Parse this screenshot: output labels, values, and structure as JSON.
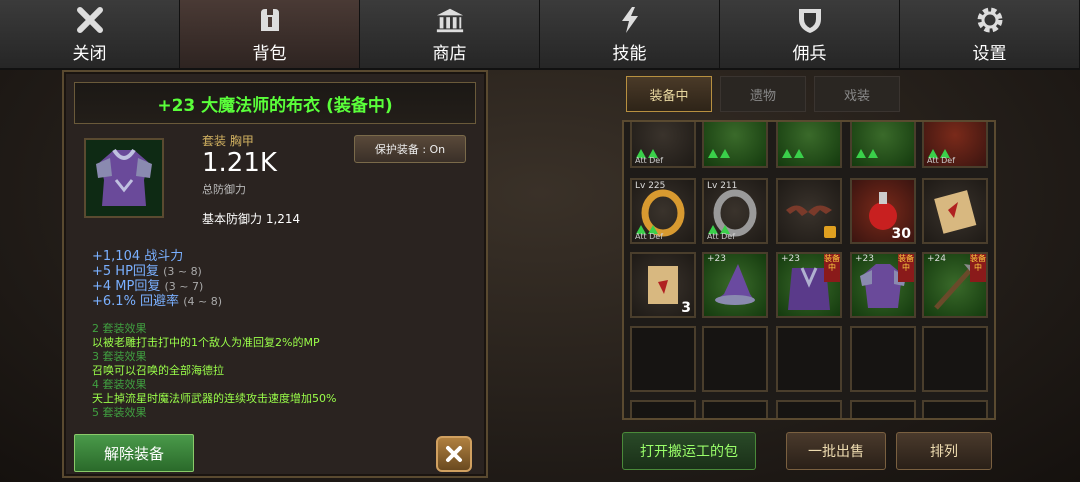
{
  "nav": [
    {
      "label": "关闭",
      "icon": "close-icon"
    },
    {
      "label": "背包",
      "icon": "backpack-icon"
    },
    {
      "label": "商店",
      "icon": "shop-icon"
    },
    {
      "label": "技能",
      "icon": "skill-icon"
    },
    {
      "label": "佣兵",
      "icon": "mercenary-icon"
    },
    {
      "label": "设置",
      "icon": "gear-icon"
    }
  ],
  "item": {
    "title": "+23 大魔法师的布衣 (装备中)",
    "category": "套装 胸甲",
    "total_defense": "1.21K",
    "total_defense_label": "总防御力",
    "base_defense": "基本防御力 1,214",
    "protect_label": "保护装备 : On",
    "stats": [
      {
        "text": "+1,104 战斗力",
        "range": ""
      },
      {
        "text": "+5 HP回复",
        "range": "(3 ~ 8)"
      },
      {
        "text": "+4 MP回复",
        "range": "(3 ~ 7)"
      },
      {
        "text": "+6.1% 回避率",
        "range": "(4 ~ 8)"
      }
    ],
    "set_effects": [
      {
        "header": "2 套装效果",
        "text": "以被老雕打击打中的1个敌人为准回复2%的MP"
      },
      {
        "header": "3 套装效果",
        "text": "召唤可以召唤的全部海德拉"
      },
      {
        "header": "4 套装效果",
        "text": "天上掉流星时魔法师武器的连续攻击速度增加50%"
      },
      {
        "header": "5 套装效果",
        "text": ""
      }
    ],
    "unequip_label": "解除装备"
  },
  "tabs": [
    "装备中",
    "遗物",
    "戏装"
  ],
  "slots": {
    "att_def": "Att Def",
    "ring1_level": "Lv 225",
    "ring2_level": "Lv 211",
    "potion_count": "30",
    "scroll2_count": "3",
    "plus23": "+23",
    "plus24": "+24",
    "equipped_tag": "装备中"
  },
  "buttons": {
    "open_porter": "打开搬运工的包",
    "bulk_sell": "一批出售",
    "sort": "排列"
  },
  "colors": {
    "title_green": "#5aff3a",
    "stat_blue": "#7ab0ff",
    "set_green": "#9aff4a",
    "gold_border": "#b89040"
  }
}
